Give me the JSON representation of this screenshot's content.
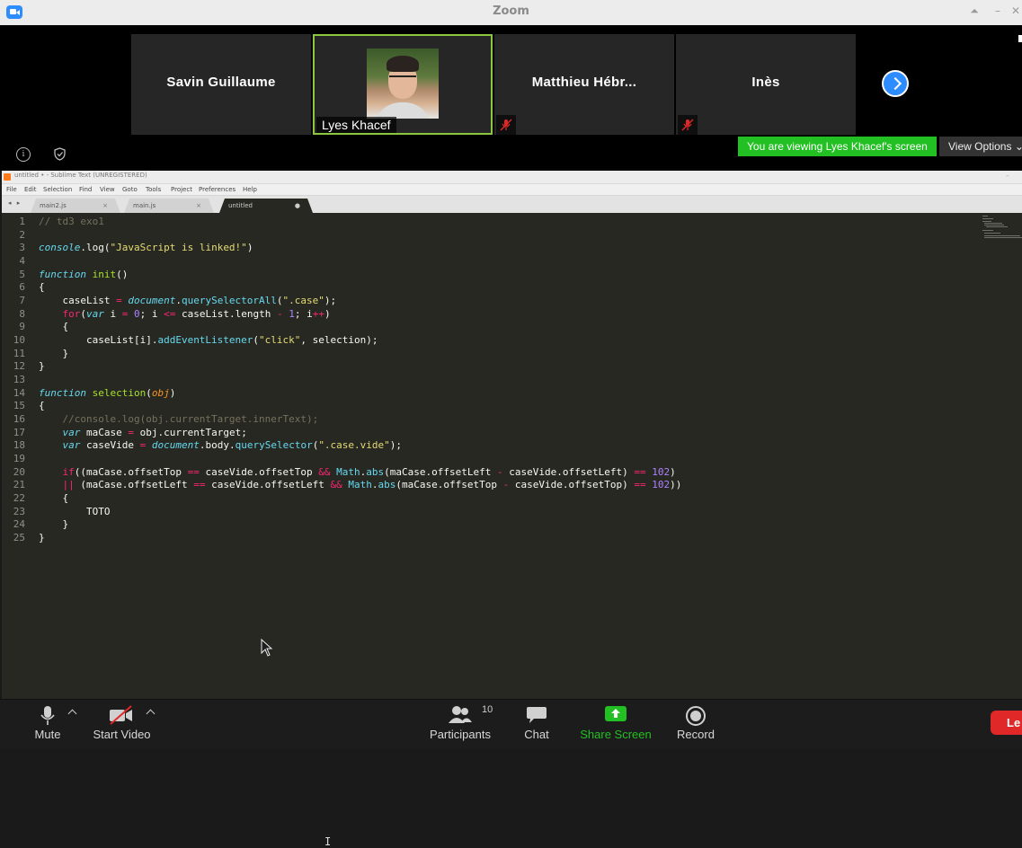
{
  "zoom": {
    "window_title": "Zoom",
    "window_buttons": [
      "⏶",
      "–",
      "✕"
    ],
    "tiles": [
      {
        "name": "Savin Guillaume"
      },
      {
        "name": "Lyes Khacef"
      },
      {
        "name": "Matthieu Hébr..."
      },
      {
        "name": "Inès"
      }
    ],
    "viewing_banner": "You are viewing Lyes Khacef's screen",
    "view_options": "View Options ⌄",
    "info_icon_glyph": "i",
    "toolbar": {
      "mute": "Mute",
      "start_video": "Start Video",
      "participants": "Participants",
      "participants_count": "10",
      "chat": "Chat",
      "share_screen": "Share Screen",
      "record": "Record",
      "leave": "Le"
    },
    "colors": {
      "active_speaker_border": "#8cc63f",
      "banner_green": "#23c023",
      "share_green": "#23c023",
      "leave_red": "#e02828",
      "accent_blue": "#2d8cff"
    }
  },
  "sublime": {
    "window_title": "untitled • - Sublime Text (UNREGISTERED)",
    "menu": [
      "File",
      "Edit",
      "Selection",
      "Find",
      "View",
      "Goto",
      "Tools",
      "Project",
      "Preferences",
      "Help"
    ],
    "tab_arrows": "◂ ▸",
    "tabs": [
      {
        "label": "main2.js",
        "close": "×"
      },
      {
        "label": "main.js",
        "close": "×"
      },
      {
        "label": "untitled",
        "close": "●"
      }
    ],
    "line_numbers": [
      "1",
      "2",
      "3",
      "4",
      "5",
      "6",
      "7",
      "8",
      "9",
      "10",
      "11",
      "12",
      "13",
      "14",
      "15",
      "16",
      "17",
      "18",
      "19",
      "20",
      "21",
      "22",
      "23",
      "24",
      "25"
    ],
    "code": {
      "l1_comment": "// td3 exo1",
      "l3_console": "console",
      "l3_log": ".log(",
      "l3_str": "\"JavaScript is linked!\"",
      "l3_end": ")",
      "l5_function": "function",
      "l5_name": "init",
      "l5_parens": "()",
      "l6": "{",
      "l7_ind": "    caseList ",
      "l7_eq": "=",
      "l7_doc": "document",
      "l7_dot": ".",
      "l7_qsa": "querySelectorAll",
      "l7_p": "(",
      "l7_str": "\".case\"",
      "l7_end": ");",
      "l8_ind": "    ",
      "l8_for": "for",
      "l8_p": "(",
      "l8_var": "var",
      "l8_i": " i ",
      "l8_eq": "=",
      "l8_sp": " ",
      "l8_0": "0",
      "l8_semi": "; i ",
      "l8_le": "<=",
      "l8_cl": " caseList.length ",
      "l8_minus": "-",
      "l8_sp2": " ",
      "l8_1": "1",
      "l8_semi2": "; i",
      "l8_pp": "++",
      "l8_end": ")",
      "l9": "    {",
      "l10_ind": "        caseList[i].",
      "l10_ael": "addEventListener",
      "l10_p": "(",
      "l10_str": "\"click\"",
      "l10_end": ", selection);",
      "l11": "    }",
      "l12": "}",
      "l14_function": "function",
      "l14_name": "selection",
      "l14_p": "(",
      "l14_param": "obj",
      "l14_end": ")",
      "l15": "{",
      "l16_comment": "    //console.log(obj.currentTarget.innerText);",
      "l17_ind": "    ",
      "l17_var": "var",
      "l17_mid": " maCase ",
      "l17_eq": "=",
      "l17_end": " obj.currentTarget;",
      "l18_ind": "    ",
      "l18_var": "var",
      "l18_mid": " caseVide ",
      "l18_eq": "=",
      "l18_sp": " ",
      "l18_doc": "document",
      "l18_body": ".body.",
      "l18_qs": "querySelector",
      "l18_p": "(",
      "l18_str": "\".case.vide\"",
      "l18_end": ");",
      "l20_ind": "    ",
      "l20_if": "if",
      "l20_a": "((maCase.offsetTop ",
      "l20_eqeq": "==",
      "l20_b": " caseVide.offsetTop ",
      "l20_and": "&&",
      "l20_sp": " ",
      "l20_math": "Math",
      "l20_dot": ".",
      "l20_abs": "abs",
      "l20_c": "(maCase.offsetLeft ",
      "l20_minus": "-",
      "l20_d": " caseVide.offsetLeft) ",
      "l20_eqeq2": "==",
      "l20_sp2": " ",
      "l20_num": "102",
      "l20_end": ")",
      "l21_ind": "    ",
      "l21_or": "||",
      "l21_a": " (maCase.offsetLeft ",
      "l21_eqeq": "==",
      "l21_b": " caseVide.offsetLeft ",
      "l21_and": "&&",
      "l21_sp": " ",
      "l21_math": "Math",
      "l21_dot": ".",
      "l21_abs": "abs",
      "l21_c": "(maCase.offsetTop ",
      "l21_minus": "-",
      "l21_d": " caseVide.offsetTop) ",
      "l21_eqeq2": "==",
      "l21_sp2": " ",
      "l21_num": "102",
      "l21_end": "))",
      "l22": "    {",
      "l23": "        TOTO",
      "l24": "    }",
      "l25": "}"
    },
    "colors": {
      "background": "#272822",
      "keyword": "#f92672",
      "storage": "#66d9ef",
      "function_name": "#a6e22e",
      "string": "#e6db74",
      "number": "#ae81ff",
      "parameter": "#fd971f",
      "comment": "#75715e"
    }
  }
}
